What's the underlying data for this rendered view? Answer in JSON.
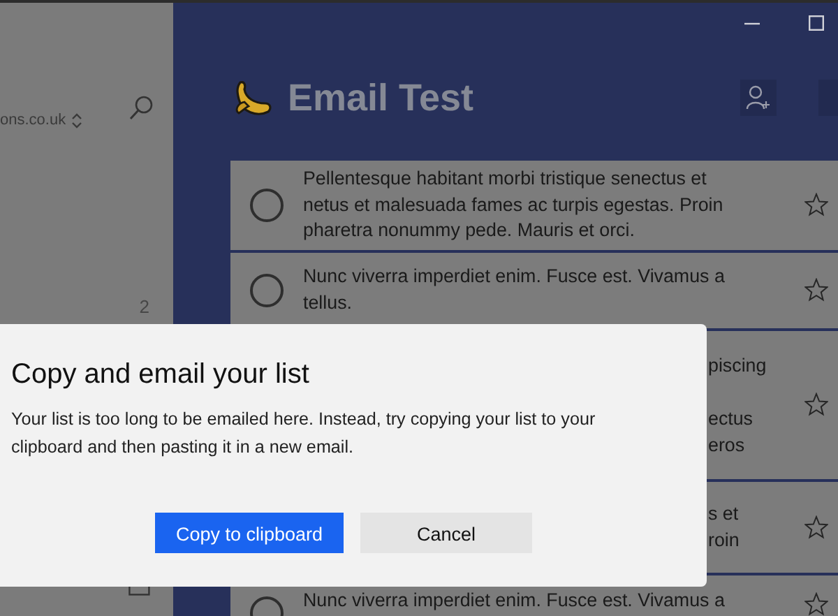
{
  "window": {
    "controls": [
      {
        "kind": "minimize"
      },
      {
        "kind": "maximize"
      }
    ]
  },
  "sidebar": {
    "account": "ons.co.uk",
    "count": "2"
  },
  "list": {
    "title": "Email Test",
    "tasks": [
      {
        "kind": "full",
        "text": "Pellentesque habitant morbi tristique senectus et netus et malesuada fames ac turpis egestas. Proin pharetra nonummy pede. Mauris et orci.",
        "completed": false,
        "starred": false
      },
      {
        "kind": "full",
        "text": "Nunc viverra imperdiet enim. Fusce est. Vivamus a tellus.",
        "completed": false,
        "starred": false
      },
      {
        "kind": "partial",
        "lines": [
          "piscing",
          "ectus",
          "eros"
        ],
        "starred": false
      },
      {
        "kind": "partial",
        "lines": [
          "s et",
          "roin"
        ],
        "starred": false
      },
      {
        "kind": "full",
        "text": "Nunc viverra imperdiet enim. Fusce est. Vivamus a",
        "completed": false,
        "starred": false
      }
    ]
  },
  "dialog": {
    "title": "Copy and email your list",
    "message": "Your list is too long to be emailed here. Instead, try copying your list to your clipboard and then pasting it in a new email.",
    "buttons": [
      {
        "label": "Copy to clipboard",
        "primary": true
      },
      {
        "label": "Cancel",
        "primary": false
      }
    ]
  }
}
